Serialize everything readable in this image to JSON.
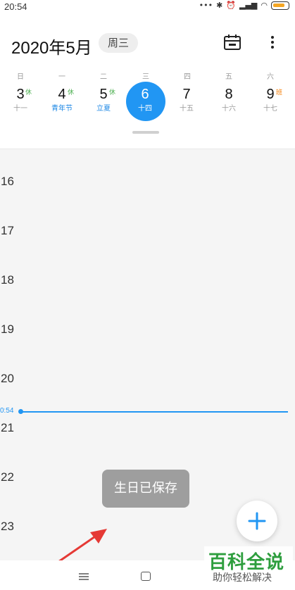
{
  "status": {
    "time": "20:54",
    "icons": [
      "more-dots-icon",
      "bluetooth-icon",
      "alarm-icon",
      "signal-icon",
      "wifi-icon",
      "battery-icon"
    ]
  },
  "header": {
    "month_title": "2020年5月",
    "weekday": "周三"
  },
  "week_labels": [
    "日",
    "一",
    "二",
    "三",
    "四",
    "五",
    "六"
  ],
  "days": [
    {
      "num": "3",
      "sub": "十一",
      "badge": "休",
      "selected": false
    },
    {
      "num": "4",
      "sub": "青年节",
      "badge": "休",
      "selected": false
    },
    {
      "num": "5",
      "sub": "立夏",
      "badge": "休",
      "selected": false
    },
    {
      "num": "6",
      "sub": "十四",
      "badge": "",
      "selected": true
    },
    {
      "num": "7",
      "sub": "十五",
      "badge": "",
      "selected": false
    },
    {
      "num": "8",
      "sub": "十六",
      "badge": "",
      "selected": false
    },
    {
      "num": "9",
      "sub": "十七",
      "badge": "班",
      "selected": false
    }
  ],
  "timeline": {
    "hours": [
      "16",
      "17",
      "18",
      "19",
      "20",
      "21",
      "22",
      "23"
    ],
    "now_time": "0:54"
  },
  "toast": "生日已保存",
  "watermark": {
    "title": "百科全说",
    "subtitle": "助你轻松解决"
  },
  "colors": {
    "accent": "#2196f3",
    "rest_badge": "#4caf50",
    "work_badge": "#f57c00",
    "watermark": "#2e9e3e"
  }
}
